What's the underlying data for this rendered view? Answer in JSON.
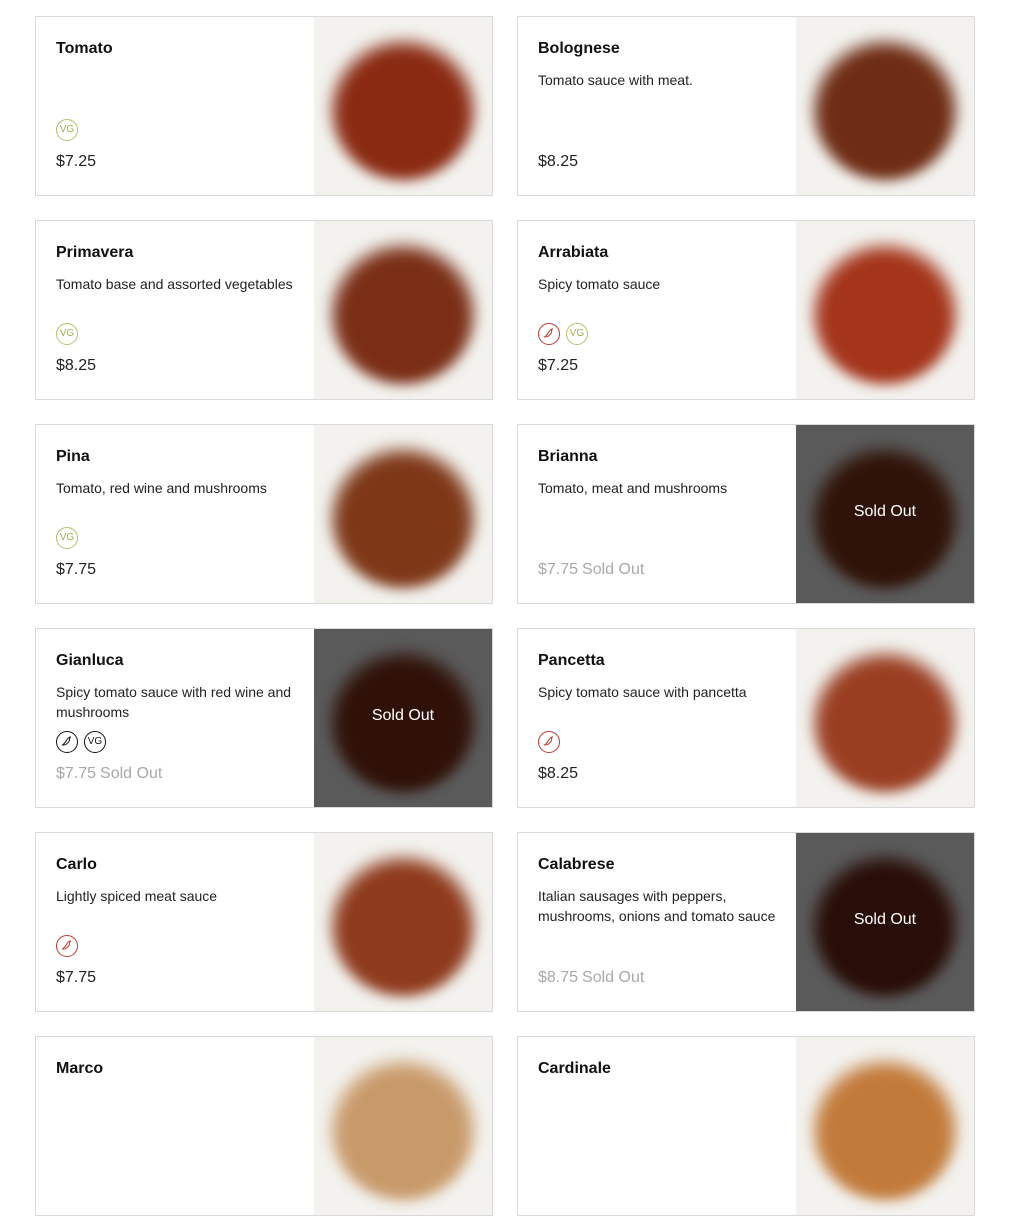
{
  "menu": {
    "items": [
      {
        "name": "Tomato",
        "description": "",
        "price": "$7.25",
        "badges": [
          "vg"
        ],
        "sold_out": false,
        "sauce_color": "#8a2a12"
      },
      {
        "name": "Bolognese",
        "description": "Tomato sauce with meat.",
        "price": "$8.25",
        "badges": [],
        "sold_out": false,
        "sauce_color": "#6e2c14"
      },
      {
        "name": "Primavera",
        "description": "Tomato base and assorted vegetables",
        "price": "$8.25",
        "badges": [
          "vg"
        ],
        "sold_out": false,
        "sauce_color": "#7a2e16"
      },
      {
        "name": "Arrabiata",
        "description": "Spicy tomato sauce",
        "price": "$7.25",
        "badges": [
          "spicy",
          "vg"
        ],
        "sold_out": false,
        "sauce_color": "#a4341a"
      },
      {
        "name": "Pina",
        "description": "Tomato, red wine and mushrooms",
        "price": "$7.75",
        "badges": [
          "vg"
        ],
        "sold_out": false,
        "sauce_color": "#7e3818"
      },
      {
        "name": "Brianna",
        "description": "Tomato, meat and mushrooms",
        "price": "$7.75",
        "badges": [],
        "sold_out": true,
        "sauce_color": "#6a2a12"
      },
      {
        "name": "Gianluca",
        "description": "Spicy tomato sauce with red wine and mushrooms",
        "price": "$7.75",
        "badges": [
          "spicy",
          "vg"
        ],
        "sold_out": true,
        "sauce_color": "#6a2612"
      },
      {
        "name": "Pancetta",
        "description": "Spicy tomato sauce with pancetta",
        "price": "$8.25",
        "badges": [
          "spicy"
        ],
        "sold_out": false,
        "sauce_color": "#9a3e22"
      },
      {
        "name": "Carlo",
        "description": "Lightly spiced meat sauce",
        "price": "$7.75",
        "badges": [
          "spicy"
        ],
        "sold_out": false,
        "sauce_color": "#8e3a1c"
      },
      {
        "name": "Calabrese",
        "description": "Italian sausages with peppers, mushrooms, onions and tomato sauce",
        "price": "$8.75",
        "badges": [],
        "sold_out": true,
        "sauce_color": "#5a1e10"
      },
      {
        "name": "Marco",
        "description": "",
        "price": "",
        "badges": [],
        "sold_out": false,
        "sauce_color": "#c89a6a"
      },
      {
        "name": "Cardinale",
        "description": "",
        "price": "",
        "badges": [],
        "sold_out": false,
        "sauce_color": "#c27a3a"
      }
    ],
    "sold_out_label": "Sold Out",
    "vegetarian_badge_label": "VG",
    "spicy_icon": "chili-pepper-icon"
  }
}
